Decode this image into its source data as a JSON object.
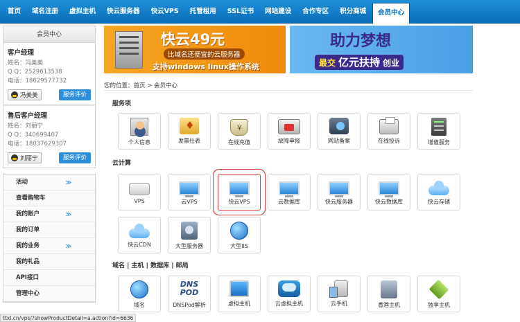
{
  "nav": {
    "items": [
      "首页",
      "域名注册",
      "虚拟主机",
      "快云服务器",
      "快云VPS",
      "托管租用",
      "SSL证书",
      "网站建设",
      "合作专区",
      "积分商城",
      "会员中心"
    ],
    "active_index": 10
  },
  "sidebar": {
    "title": "会员中心",
    "account_manager": {
      "title": "客户经理",
      "name": "姓名：冯美美",
      "qq": "Q Q：2529613538",
      "phone": "电话：18629577732",
      "qq_button": "冯美美",
      "eval_button": "服务评价"
    },
    "support_manager": {
      "title": "售后客户经理",
      "name": "姓名：刘丽宁",
      "qq": "Q Q：340699407",
      "phone": "电话：18037629307",
      "qq_button": "刘丽宁",
      "eval_button": "服务评价"
    },
    "menu": [
      {
        "label": "活动",
        "chevron": true
      },
      {
        "label": "查看购物车",
        "chevron": false
      },
      {
        "label": "我的账户",
        "chevron": true
      },
      {
        "label": "我的订单",
        "chevron": false
      },
      {
        "label": "我的业务",
        "chevron": true
      },
      {
        "label": "我的礼品",
        "chevron": false
      },
      {
        "label": "API接口",
        "chevron": false
      },
      {
        "label": "管理中心",
        "chevron": false
      }
    ]
  },
  "banners": {
    "left": {
      "title": "快云49元",
      "subtitle": "比域名还便宜的云服务器",
      "os_line": "支持windows linux操作系统"
    },
    "right": {
      "title": "助力梦想",
      "tag_a": "最交",
      "tag_b": "亿元扶持",
      "tag_c": "创业"
    }
  },
  "breadcrumb": "您的位置：首页 > 会员中心",
  "sections": [
    {
      "title": "服务项",
      "tiles": [
        {
          "label": "个人信息",
          "icon": "person-icon"
        },
        {
          "label": "发票仕表",
          "icon": "ticket-icon"
        },
        {
          "label": "在线充值",
          "icon": "money-bag-icon"
        },
        {
          "label": "故障申报",
          "icon": "truck-icon"
        },
        {
          "label": "网站备案",
          "icon": "network-icon"
        },
        {
          "label": "在线投诉",
          "icon": "printer-icon"
        },
        {
          "label": "增值服务",
          "icon": "server-rack-icon"
        }
      ]
    },
    {
      "title": "云计算",
      "tiles": [
        {
          "label": "VPS",
          "icon": "disk-icon"
        },
        {
          "label": "云VPS",
          "icon": "monitor-icon"
        },
        {
          "label": "快云VPS",
          "icon": "monitor-icon",
          "selected": true
        },
        {
          "label": "云数据库",
          "icon": "monitor-icon"
        },
        {
          "label": "快云服务器",
          "icon": "monitor-icon"
        },
        {
          "label": "快云数据库",
          "icon": "monitor-icon"
        },
        {
          "label": "快云存储",
          "icon": "cloud-icon"
        },
        {
          "label": "快云CDN",
          "icon": "cloud-icon"
        },
        {
          "label": "大型服务器",
          "icon": "hard-drive-icon"
        },
        {
          "label": "大型IIS",
          "icon": "globe-icon"
        }
      ]
    },
    {
      "title": "域名 | 主机 | 数据库 | 邮局",
      "tiles": [
        {
          "label": "域名",
          "icon": "globe-icon"
        },
        {
          "label": "DNSPod解析",
          "icon": "dnspod-icon",
          "icon_text": "DNS POD"
        },
        {
          "label": "虚拟主机",
          "icon": "pc-icon"
        },
        {
          "label": "云虚拟主机",
          "icon": "cloud-pc-icon"
        },
        {
          "label": "云手机",
          "icon": "mobile-icon"
        },
        {
          "label": "香港主机",
          "icon": "hk-server-icon"
        },
        {
          "label": "独享主机",
          "icon": "box-icon"
        }
      ]
    }
  ],
  "statusbar": "ttxl.cn/vps/?showProductDetail=a.action?id=6636"
}
